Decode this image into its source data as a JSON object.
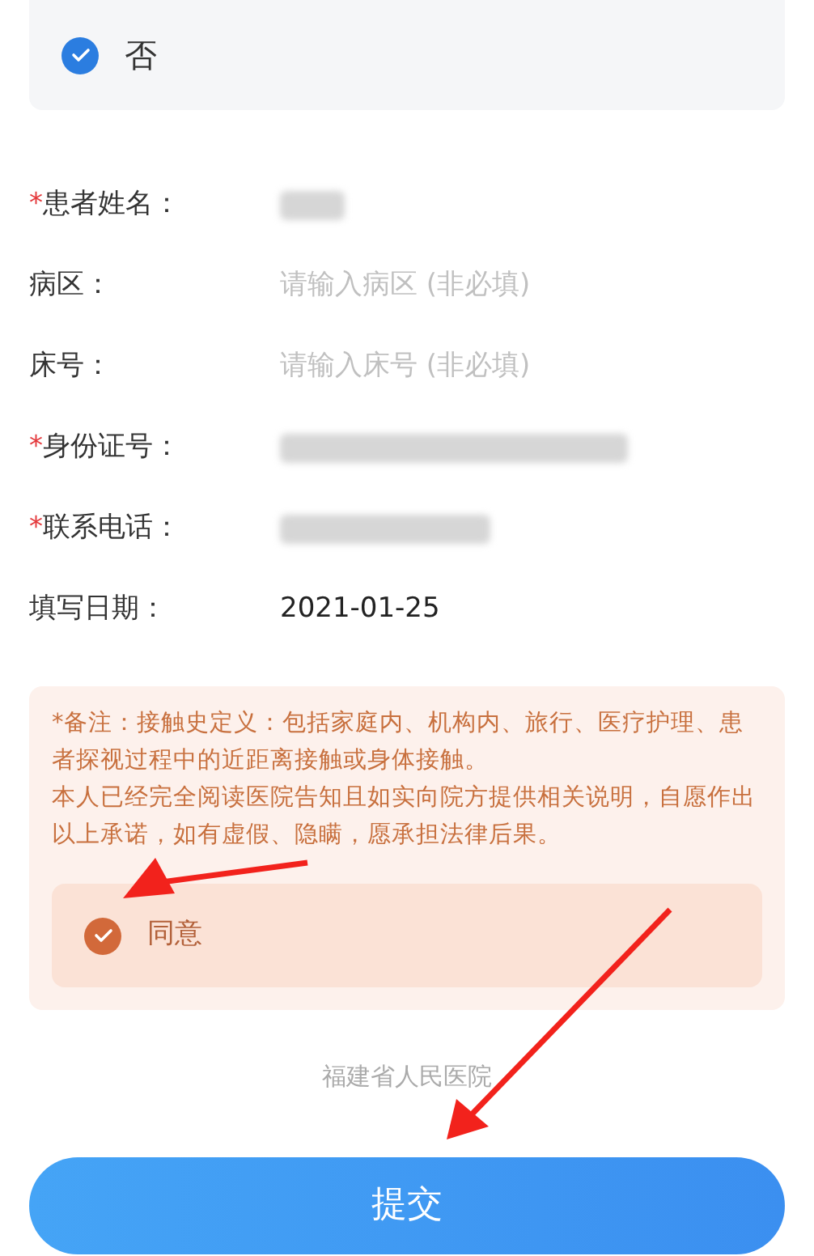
{
  "option": {
    "label": "否",
    "checked": true
  },
  "fields": [
    {
      "mark": "*",
      "label": "患者姓名：",
      "kind": "redacted"
    },
    {
      "label": "病区：",
      "kind": "input",
      "placeholder": "请输入病区 (非必填)"
    },
    {
      "label": "床号：",
      "kind": "input",
      "placeholder": "请输入床号 (非必填)"
    },
    {
      "mark": "*",
      "label": "身份证号：",
      "kind": "redacted"
    },
    {
      "mark": "*",
      "label": "联系电话：",
      "kind": "redacted"
    },
    {
      "label": "填写日期：",
      "kind": "text",
      "value": "2021-01-25"
    }
  ],
  "notice": {
    "paragraphs": [
      "*备注：接触史定义：包括家庭内、机构内、旅行、医疗护理、患者探视过程中的近距离接触或身体接触。",
      "本人已经完全阅读医院告知且如实向院方提供相关说明，自愿作出以上承诺，如有虚假、隐瞒，愿承担法律后果。"
    ],
    "agree": {
      "label": "同意",
      "checked": true
    }
  },
  "footer": "福建省人民医院",
  "submit": "提交"
}
